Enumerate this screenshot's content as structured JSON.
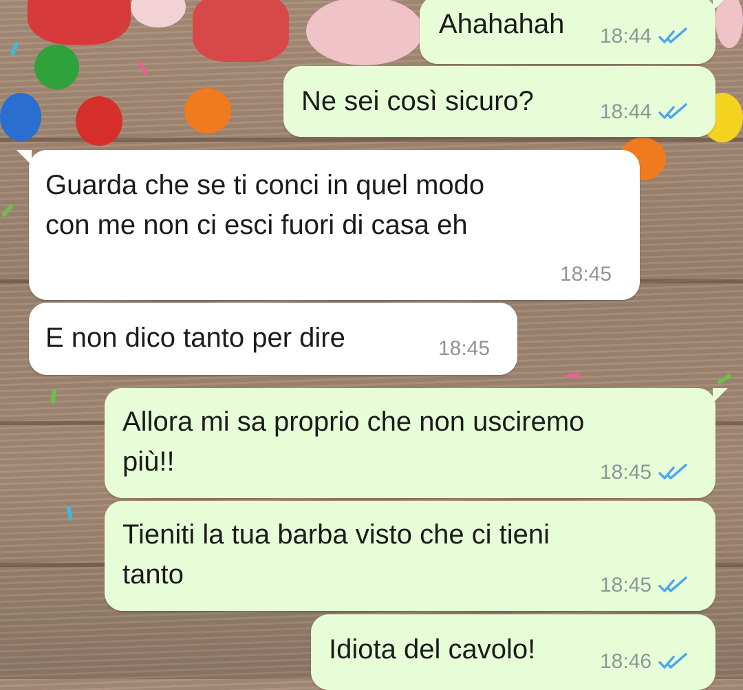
{
  "messages": [
    {
      "direction": "out",
      "text": "Ahahahah",
      "time": "18:44",
      "status": "read"
    },
    {
      "direction": "out",
      "text": "Ne sei così sicuro?",
      "time": "18:44",
      "status": "read"
    },
    {
      "direction": "in",
      "text": "Guarda che se ti conci in quel modo\ncon me non ci esci fuori di casa eh",
      "time": "18:45"
    },
    {
      "direction": "in",
      "text": "E non dico tanto per dire",
      "time": "18:45"
    },
    {
      "direction": "out",
      "text": "Allora mi sa proprio che non usciremo\npiù!!",
      "time": "18:45",
      "status": "read"
    },
    {
      "direction": "out",
      "text": "Tieniti la tua barba visto che ci tieni\ntanto",
      "time": "18:45",
      "status": "read"
    },
    {
      "direction": "out",
      "text": "Idiota del cavolo!",
      "time": "18:46",
      "status": "read"
    }
  ],
  "colors": {
    "outgoing_bubble": "#e6fdd8",
    "incoming_bubble": "#ffffff",
    "read_tick": "#4fa6ee",
    "timestamp": "#8d9696"
  },
  "icons": {
    "read_status": "double-check-icon"
  }
}
